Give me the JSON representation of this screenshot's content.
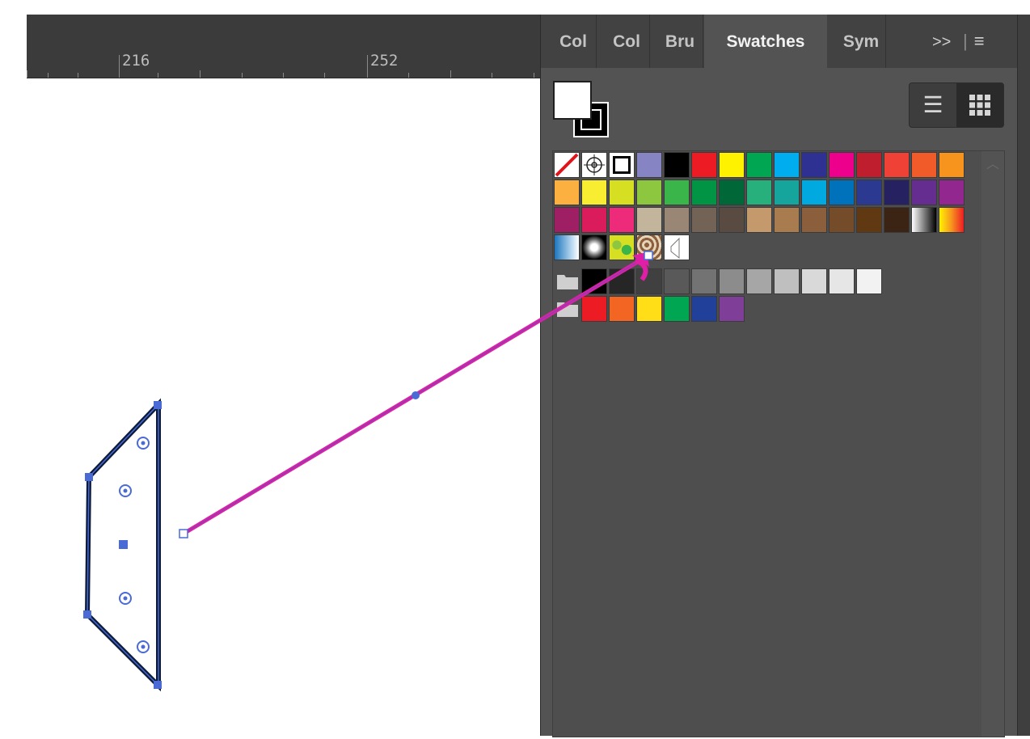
{
  "ruler": {
    "labels": [
      "216",
      "252"
    ]
  },
  "panel": {
    "tabs": [
      {
        "label": "Col",
        "active": false
      },
      {
        "label": "Col",
        "active": false
      },
      {
        "label": "Bru",
        "active": false
      },
      {
        "label": "Swatches",
        "active": true
      },
      {
        "label": "Sym",
        "active": false
      }
    ],
    "overflow_label": ">>",
    "menu_icon": "hamburger-menu-icon",
    "view_list_icon": "list-view-icon",
    "view_grid_icon": "grid-view-icon",
    "fill_color": "#ffffff",
    "stroke_color": "#000000"
  },
  "swatches": {
    "row1": [
      "none",
      "registration",
      "white-stroke",
      "#8784c4",
      "#000000",
      "#ed1c24",
      "#fff200",
      "#00a651",
      "#00aeef",
      "#2e3192",
      "#ec008c",
      "#be1e2d",
      "#ef4136",
      "#f15a29",
      "#f7941e"
    ],
    "row2": [
      "#fbb040",
      "#f9ed32",
      "#d7df23",
      "#8dc63f",
      "#39b54a",
      "#009444",
      "#006838",
      "#27b07b",
      "#15a59c",
      "#00a9e0",
      "#0072bc",
      "#2b3990",
      "#262262",
      "#662d91",
      "#92278f"
    ],
    "row3": [
      "#9e1f63",
      "#da1c5c",
      "#ee2a7b",
      "#c2b59b",
      "#998675",
      "#736357",
      "#594a42",
      "#c49a6c",
      "#a97c50",
      "#8b5e3c",
      "#754c29",
      "#603913",
      "#3c2415",
      "gradient-gray",
      "gradient-yellow"
    ],
    "row4": [
      "pattern-blue-fade",
      "pattern-radial",
      "pattern-foliage",
      "pattern-swirl",
      "pattern-outline"
    ],
    "gray_group": [
      "#000000",
      "#262626",
      "#404040",
      "#595959",
      "#737373",
      "#8c8c8c",
      "#a6a6a6",
      "#bfbfbf",
      "#d9d9d9",
      "#e6e6e6",
      "#f2f2f2"
    ],
    "bright_group": [
      "#ed1c24",
      "#f26522",
      "#ffde17",
      "#00a651",
      "#21409a",
      "#7f3f98"
    ]
  },
  "colors": {
    "path_magenta": "#e01fa6",
    "anchor_blue": "#4a6bd6",
    "shape_stroke": "#0d1b3a"
  }
}
